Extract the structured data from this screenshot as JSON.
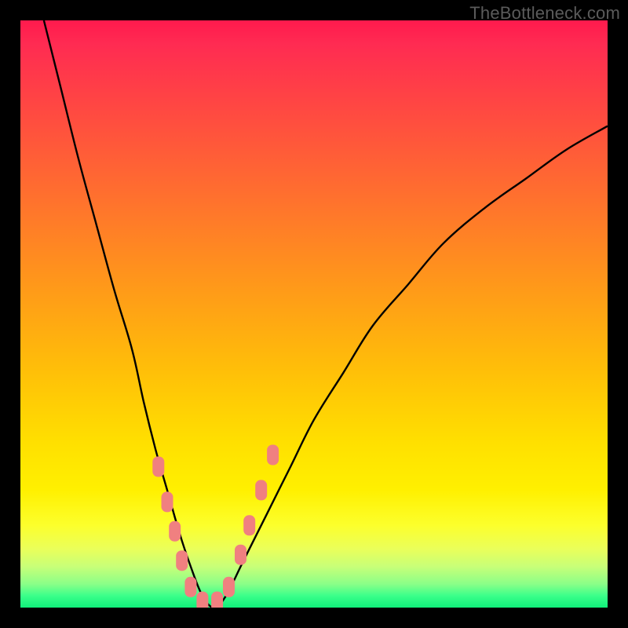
{
  "watermark": {
    "text": "TheBottleneck.com"
  },
  "colors": {
    "frame": "#000000",
    "curve": "#000000",
    "marker_fill": "#f08080",
    "marker_stroke": "#c05050",
    "gradient_stops": [
      "#ff1a4d",
      "#ff2b52",
      "#ff4046",
      "#ff6036",
      "#ff8026",
      "#ffa016",
      "#ffc008",
      "#ffe000",
      "#fff000",
      "#fcff2c",
      "#eaff5a",
      "#c8ff78",
      "#8aff88",
      "#3aff8a",
      "#10f07a"
    ]
  },
  "chart_data": {
    "type": "line",
    "title": "",
    "xlabel": "",
    "ylabel": "",
    "xlim": [
      0,
      100
    ],
    "ylim": [
      0,
      100
    ],
    "note": "x and y are percent coordinates inside the gradient plot area; y=0 is top, y=100 is bottom. Curve estimated from pixels (no axis labels present).",
    "series": [
      {
        "name": "bottleneck-curve",
        "x": [
          4,
          7,
          10,
          13,
          16,
          19,
          21,
          23,
          25,
          27,
          29,
          31,
          33,
          35,
          38,
          42,
          46,
          50,
          55,
          60,
          66,
          72,
          79,
          86,
          93,
          100
        ],
        "y": [
          0,
          12,
          24,
          35,
          46,
          56,
          65,
          73,
          80,
          87,
          93,
          98,
          100,
          98,
          92,
          84,
          76,
          68,
          60,
          52,
          45,
          38,
          32,
          27,
          22,
          18
        ]
      }
    ],
    "markers": {
      "name": "highlighted-points",
      "shape": "rounded-rect",
      "points": [
        {
          "x": 23.5,
          "y": 76
        },
        {
          "x": 25.0,
          "y": 82
        },
        {
          "x": 26.3,
          "y": 87
        },
        {
          "x": 27.5,
          "y": 92
        },
        {
          "x": 29.0,
          "y": 96.5
        },
        {
          "x": 31.0,
          "y": 99
        },
        {
          "x": 33.5,
          "y": 99
        },
        {
          "x": 35.5,
          "y": 96.5
        },
        {
          "x": 37.5,
          "y": 91
        },
        {
          "x": 39.0,
          "y": 86
        },
        {
          "x": 41.0,
          "y": 80
        },
        {
          "x": 43.0,
          "y": 74
        }
      ]
    }
  }
}
